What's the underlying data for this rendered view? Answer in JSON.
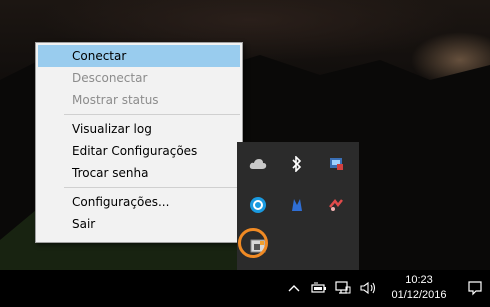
{
  "menu": {
    "items": [
      {
        "label": "Conectar",
        "state": "highlighted"
      },
      {
        "label": "Desconectar",
        "state": "disabled"
      },
      {
        "label": "Mostrar status",
        "state": "disabled"
      },
      {
        "label": "Visualizar log",
        "state": "normal"
      },
      {
        "label": "Editar Configurações",
        "state": "normal"
      },
      {
        "label": "Trocar senha",
        "state": "normal"
      },
      {
        "label": "Configurações...",
        "state": "normal"
      },
      {
        "label": "Sair",
        "state": "normal"
      }
    ]
  },
  "tray_popup": {
    "icons": [
      "cloud-icon",
      "bluetooth-icon",
      "network-app-icon",
      "circle-app-icon",
      "blue-app-icon",
      "red-app-icon",
      "openvpn-gui-icon"
    ]
  },
  "taskbar": {
    "icons": [
      "chevron-up-icon",
      "battery-icon",
      "network-icon",
      "volume-icon",
      "notification-icon"
    ],
    "clock": {
      "time": "10:23",
      "date": "01/12/2016"
    }
  },
  "colors": {
    "menu_highlight": "#99ccee",
    "ring": "#f08a24",
    "taskbar": "#000000"
  }
}
